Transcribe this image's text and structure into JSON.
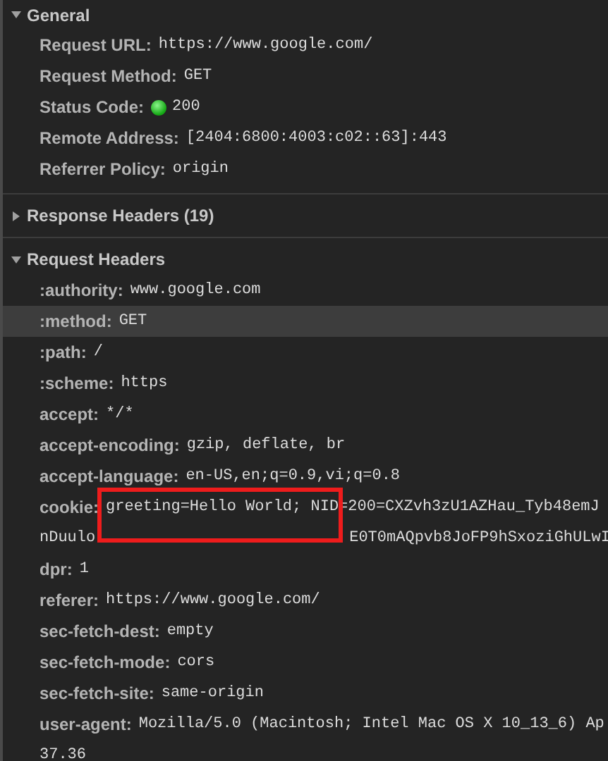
{
  "sections": [
    {
      "title": "General",
      "expanded": true,
      "rows": [
        {
          "kind": "plain",
          "name": "Request URL:",
          "value": "https://www.google.com/",
          "selected": false
        },
        {
          "kind": "plain",
          "name": "Request Method:",
          "value": "GET",
          "selected": false
        },
        {
          "kind": "status",
          "name": "Status Code:",
          "value": "200",
          "selected": false
        },
        {
          "kind": "plain",
          "name": "Remote Address:",
          "value": "[2404:6800:4003:c02::63]:443",
          "selected": false
        },
        {
          "kind": "plain",
          "name": "Referrer Policy:",
          "value": "origin",
          "selected": false
        }
      ]
    },
    {
      "title": "Response Headers (19)",
      "expanded": false
    },
    {
      "title": "Request Headers",
      "expanded": true,
      "rows": [
        {
          "kind": "plain",
          "name": ":authority:",
          "value": "www.google.com",
          "selected": false
        },
        {
          "kind": "plain",
          "name": ":method:",
          "value": "GET",
          "selected": true
        },
        {
          "kind": "plain",
          "name": ":path:",
          "value": "/",
          "selected": false
        },
        {
          "kind": "plain",
          "name": ":scheme:",
          "value": "https",
          "selected": false
        },
        {
          "kind": "plain",
          "name": "accept:",
          "value": "*/*",
          "selected": false
        },
        {
          "kind": "plain",
          "name": "accept-encoding:",
          "value": "gzip, deflate, br",
          "selected": false
        },
        {
          "kind": "plain",
          "name": "accept-language:",
          "value": "en-US,en;q=0.9,vi;q=0.8",
          "selected": false
        },
        {
          "kind": "plain",
          "name": "cookie:",
          "value": "greeting=Hello World; NID=200=CXZvh3zU1AZHau_Tyb48emJ",
          "selected": false,
          "highlighted": true,
          "continuation_parts": [
            "nDuulo",
            "E0T0mAQpvb8JoFP9hSxoziGhULwI"
          ]
        },
        {
          "kind": "plain",
          "name": "dpr:",
          "value": "1",
          "selected": false
        },
        {
          "kind": "plain",
          "name": "referer:",
          "value": "https://www.google.com/",
          "selected": false
        },
        {
          "kind": "plain",
          "name": "sec-fetch-dest:",
          "value": "empty",
          "selected": false
        },
        {
          "kind": "plain",
          "name": "sec-fetch-mode:",
          "value": "cors",
          "selected": false
        },
        {
          "kind": "plain",
          "name": "sec-fetch-site:",
          "value": "same-origin",
          "selected": false
        },
        {
          "kind": "plain",
          "name": "user-agent:",
          "value": "Mozilla/5.0 (Macintosh; Intel Mac OS X 10_13_6) Ap",
          "selected": false,
          "continuation_parts": [
            "37.36"
          ]
        }
      ]
    }
  ]
}
